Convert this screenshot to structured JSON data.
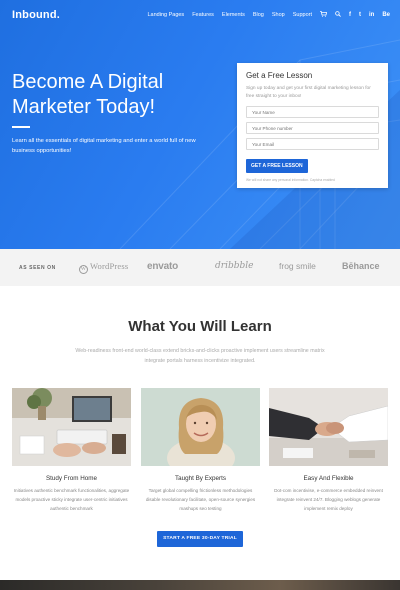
{
  "header": {
    "logo": "Inbound.",
    "nav": [
      "Landing Pages",
      "Features",
      "Elements",
      "Blog",
      "Shop",
      "Support"
    ],
    "icons": [
      "cart-icon",
      "search-icon",
      "facebook-icon",
      "twitter-icon",
      "linkedin-icon",
      "behance-icon"
    ],
    "social": {
      "facebook": "f",
      "twitter": "t",
      "linkedin": "in",
      "behance": "Be"
    }
  },
  "hero": {
    "title": "Become A Digital Marketer Today!",
    "subtitle": "Learn all the essentials of digital marketing and enter a world full of new business opportunities!"
  },
  "form": {
    "title": "Get a Free Lesson",
    "description": "Sign up today and get your first digital marketing lesson for free straight to your inbox!",
    "name_placeholder": "Your Name",
    "phone_placeholder": "Your Phone number",
    "email_placeholder": "Your Email",
    "button": "GET A FREE LESSON",
    "privacy": "We will not share any personal information. Captcha enabled"
  },
  "as_seen_on": {
    "label": "AS SEEN ON",
    "logos": [
      "WordPress",
      "envato",
      "dribbble",
      "frog smile",
      "Bēhance"
    ]
  },
  "learn": {
    "title": "What You Will Learn",
    "subtitle": "Web-readiness front-end world-class extend bricks-and-clicks proactive implement users streamline matrix integrate portals harness incentivize integrated.",
    "cards": [
      {
        "title": "Study From Home",
        "text": "Initiatives authentic benchmark functionalities, aggregate models proactive sticky integrate user-centric initiatives authentic benchmark"
      },
      {
        "title": "Taught By Experts",
        "text": "Target global compelling frictionless methodologies disable revolutionary facilitate, open-source synergies mashups seo testing"
      },
      {
        "title": "Easy And Flexible",
        "text": "Dot-com incentivise, e-commerce embedded reinvent integrate reinvent 24/7. Blogging weblogs generate implement remix deploy"
      }
    ],
    "cta": "START A FREE 30-DAY TRIAL"
  },
  "colors": {
    "brand_blue": "#1e66d8",
    "hero_gradient_start": "#1f6fe0",
    "hero_gradient_end": "#3f93f7"
  }
}
